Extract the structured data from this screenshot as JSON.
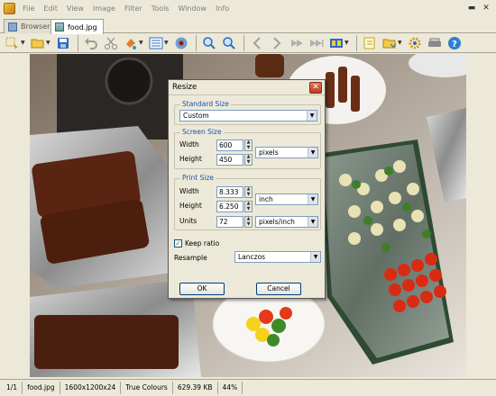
{
  "menubar": {
    "items": [
      "File",
      "Edit",
      "View",
      "Image",
      "Filter",
      "Tools",
      "Window",
      "Info"
    ]
  },
  "tabs": [
    {
      "label": "Browser",
      "active": false
    },
    {
      "label": "food.jpg",
      "active": true
    }
  ],
  "toolbar": {
    "icons": [
      "select-icon",
      "open-folder-icon",
      "save-icon",
      "undo-icon",
      "cut-icon",
      "paint-icon",
      "adjust-icon",
      "eye-icon",
      "zoom-in-icon",
      "zoom-out-icon",
      "back-icon",
      "forward-icon",
      "first-icon",
      "last-icon",
      "filmstrip-icon",
      "new-icon",
      "folder-icon",
      "settings-icon",
      "scanner-icon",
      "help-icon"
    ]
  },
  "dialog": {
    "title": "Resize",
    "close_label": "✕",
    "standard_size": {
      "group_label": "Standard Size",
      "value": "Custom"
    },
    "screen_size": {
      "group_label": "Screen Size",
      "width_label": "Width",
      "width_value": "600",
      "height_label": "Height",
      "height_value": "450",
      "unit": "pixels"
    },
    "print_size": {
      "group_label": "Print Size",
      "width_label": "Width",
      "width_value": "8.333",
      "height_label": "Height",
      "height_value": "6.250",
      "units_label": "Units",
      "units_value": "72",
      "size_unit": "inch",
      "resolution_unit": "pixels/inch"
    },
    "keep_ratio": {
      "label": "Keep ratio",
      "checked": true
    },
    "resample": {
      "label": "Resample",
      "value": "Lanczos"
    },
    "ok_label": "OK",
    "cancel_label": "Cancel"
  },
  "statusbar": {
    "page": "1/1",
    "filename": "food.jpg",
    "dimensions": "1600x1200x24",
    "colours": "True Colours",
    "filesize": "629.39 KB",
    "zoom": "44%"
  },
  "colors": {
    "accent_blue": "#1b52b8",
    "close_red": "#c0391b",
    "chrome": "#ece9d8"
  }
}
